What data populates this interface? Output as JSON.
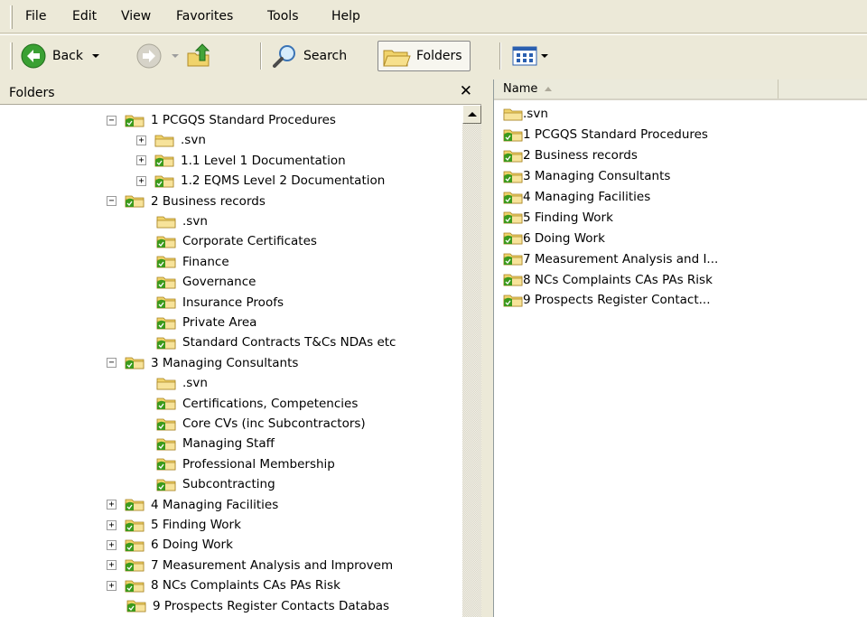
{
  "menu": [
    "File",
    "Edit",
    "View",
    "Favorites",
    "Tools",
    "Help"
  ],
  "toolbar": {
    "back_label": "Back",
    "search_label": "Search",
    "folders_label": "Folders"
  },
  "folders_pane": {
    "title": "Folders",
    "close": "✕"
  },
  "tree": [
    {
      "label": "1 PCGQS Standard Procedures",
      "level": 0,
      "expander": "−",
      "icon": "folder-svn-icon"
    },
    {
      "label": ".svn",
      "level": 1,
      "expander": "+",
      "icon": "folder-icon"
    },
    {
      "label": "1.1 Level 1 Documentation",
      "level": 1,
      "expander": "+",
      "icon": "folder-svn-icon"
    },
    {
      "label": "1.2 EQMS Level 2 Documentation",
      "level": 1,
      "expander": "+",
      "icon": "folder-svn-icon"
    },
    {
      "label": "2 Business records",
      "level": 0,
      "expander": "−",
      "icon": "folder-svn-icon"
    },
    {
      "label": ".svn",
      "level": 1,
      "expander": "",
      "icon": "folder-icon"
    },
    {
      "label": "Corporate Certificates",
      "level": 1,
      "expander": "",
      "icon": "folder-svn-icon"
    },
    {
      "label": "Finance",
      "level": 1,
      "expander": "",
      "icon": "folder-svn-icon"
    },
    {
      "label": "Governance",
      "level": 1,
      "expander": "",
      "icon": "folder-svn-icon"
    },
    {
      "label": "Insurance Proofs",
      "level": 1,
      "expander": "",
      "icon": "folder-svn-icon"
    },
    {
      "label": "Private Area",
      "level": 1,
      "expander": "",
      "icon": "folder-svn-icon"
    },
    {
      "label": "Standard Contracts T&Cs NDAs etc",
      "level": 1,
      "expander": "",
      "icon": "folder-svn-icon"
    },
    {
      "label": "3 Managing Consultants",
      "level": 0,
      "expander": "−",
      "icon": "folder-svn-icon"
    },
    {
      "label": ".svn",
      "level": 1,
      "expander": "",
      "icon": "folder-icon"
    },
    {
      "label": "Certifications, Competencies",
      "level": 1,
      "expander": "",
      "icon": "folder-svn-icon"
    },
    {
      "label": "Core CVs (inc Subcontractors)",
      "level": 1,
      "expander": "",
      "icon": "folder-svn-icon"
    },
    {
      "label": "Managing Staff",
      "level": 1,
      "expander": "",
      "icon": "folder-svn-icon"
    },
    {
      "label": "Professional Membership",
      "level": 1,
      "expander": "",
      "icon": "folder-svn-icon"
    },
    {
      "label": "Subcontracting",
      "level": 1,
      "expander": "",
      "icon": "folder-svn-icon"
    },
    {
      "label": "4 Managing Facilities",
      "level": 0,
      "expander": "+",
      "icon": "folder-svn-icon"
    },
    {
      "label": "5 Finding Work",
      "level": 0,
      "expander": "+",
      "icon": "folder-svn-icon"
    },
    {
      "label": "6 Doing Work",
      "level": 0,
      "expander": "+",
      "icon": "folder-svn-icon"
    },
    {
      "label": "7 Measurement Analysis and Improvem",
      "level": 0,
      "expander": "+",
      "icon": "folder-svn-icon"
    },
    {
      "label": "8 NCs Complaints CAs PAs Risk",
      "level": 0,
      "expander": "+",
      "icon": "folder-svn-icon"
    },
    {
      "label": "9 Prospects Register Contacts Databas",
      "level": 0,
      "expander": "",
      "icon": "folder-svn-icon"
    }
  ],
  "list_header": {
    "name": "Name"
  },
  "list": [
    {
      "label": ".svn",
      "icon": "folder-icon"
    },
    {
      "label": "1 PCGQS Standard Procedures",
      "icon": "folder-svn-icon"
    },
    {
      "label": "2 Business records",
      "icon": "folder-svn-icon"
    },
    {
      "label": "3 Managing Consultants",
      "icon": "folder-svn-icon"
    },
    {
      "label": "4 Managing Facilities",
      "icon": "folder-svn-icon"
    },
    {
      "label": "5 Finding Work",
      "icon": "folder-svn-icon"
    },
    {
      "label": "6 Doing Work",
      "icon": "folder-svn-icon"
    },
    {
      "label": "7 Measurement Analysis and I...",
      "icon": "folder-svn-icon"
    },
    {
      "label": "8 NCs Complaints CAs PAs Risk",
      "icon": "folder-svn-icon"
    },
    {
      "label": "9 Prospects Register Contact...",
      "icon": "folder-svn-icon"
    }
  ],
  "colors": {
    "svn_badge": "#3c9a1c",
    "folder": "#f0d36b"
  }
}
